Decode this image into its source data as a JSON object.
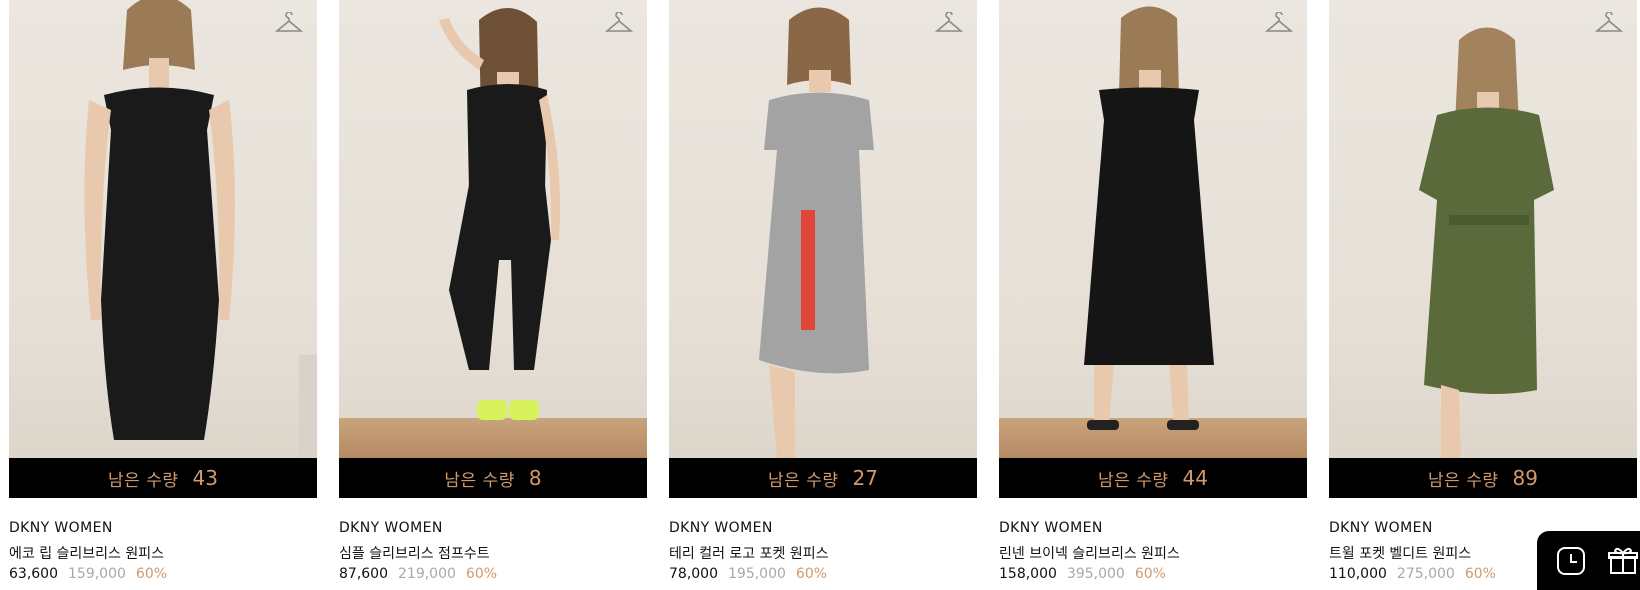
{
  "products": [
    {
      "brand": "DKNY WOMEN",
      "name": "에코 립 슬리브리스 원피스",
      "price": "63,600",
      "original_price": "159,000",
      "discount": "60%",
      "stock_label": "남은 수량",
      "stock_count": "43",
      "outfit_color": "#1a1a1a",
      "wishlist_icon": "hanger-icon"
    },
    {
      "brand": "DKNY WOMEN",
      "name": "심플 슬리브리스 점프수트",
      "price": "87,600",
      "original_price": "219,000",
      "discount": "60%",
      "stock_label": "남은 수량",
      "stock_count": "8",
      "outfit_color": "#1a1a1a",
      "wishlist_icon": "hanger-icon"
    },
    {
      "brand": "DKNY WOMEN",
      "name": "테리 컬러 로고 포켓 원피스",
      "price": "78,000",
      "original_price": "195,000",
      "discount": "60%",
      "stock_label": "남은 수량",
      "stock_count": "27",
      "outfit_color": "#a3a3a3",
      "wishlist_icon": "hanger-icon"
    },
    {
      "brand": "DKNY WOMEN",
      "name": "린넨 브이넥 슬리브리스 원피스",
      "price": "158,000",
      "original_price": "395,000",
      "discount": "60%",
      "stock_label": "남은 수량",
      "stock_count": "44",
      "outfit_color": "#151515",
      "wishlist_icon": "hanger-icon"
    },
    {
      "brand": "DKNY WOMEN",
      "name": "트윌 포켓 벨디트 원피스",
      "price": "110,000",
      "original_price": "275,000",
      "discount": "60%",
      "stock_label": "남은 수량",
      "stock_count": "89",
      "outfit_color": "#5b6a3a",
      "wishlist_icon": "hanger-icon"
    }
  ],
  "floating_panel": {
    "icons": [
      "clock-icon",
      "gift-icon"
    ]
  },
  "colors": {
    "accent": "#d09a6e",
    "stock_bar_bg": "#000000",
    "text": "#111111",
    "muted": "#a8a8a8"
  }
}
